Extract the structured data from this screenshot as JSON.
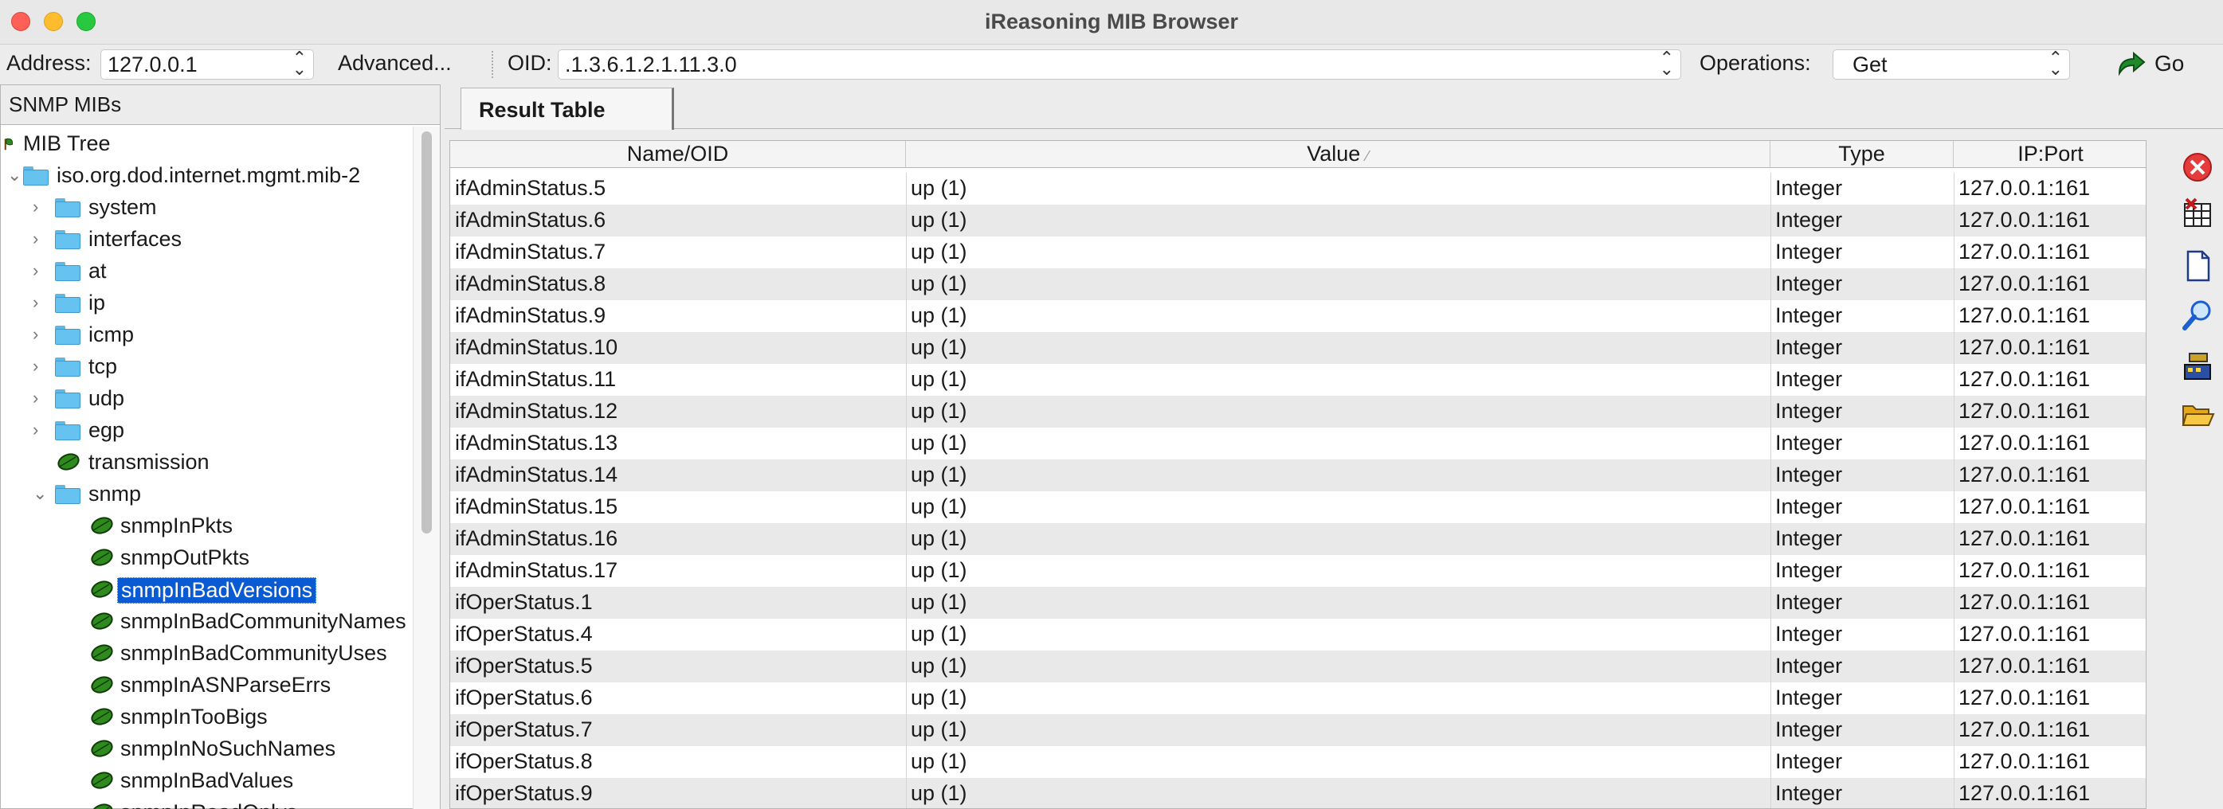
{
  "window": {
    "title": "iReasoning MIB Browser"
  },
  "toolbar": {
    "address_label": "Address:",
    "address_value": "127.0.0.1",
    "advanced_label": "Advanced...",
    "oid_label": "OID:",
    "oid_value": ".1.3.6.1.2.1.11.3.0",
    "operations_label": "Operations:",
    "operation_value": "Get",
    "go_label": "Go"
  },
  "left_panel": {
    "header": "SNMP MIBs",
    "tree": [
      {
        "label": "MIB Tree",
        "icon": "tree-icon",
        "depth": 0,
        "chevron": ""
      },
      {
        "label": "iso.org.dod.internet.mgmt.mib-2",
        "icon": "folder-icon",
        "depth": 1,
        "chevron": "expanded"
      },
      {
        "label": "system",
        "icon": "folder-icon",
        "depth": 2,
        "chevron": "collapsed"
      },
      {
        "label": "interfaces",
        "icon": "folder-icon",
        "depth": 2,
        "chevron": "collapsed"
      },
      {
        "label": "at",
        "icon": "folder-icon",
        "depth": 2,
        "chevron": "collapsed"
      },
      {
        "label": "ip",
        "icon": "folder-icon",
        "depth": 2,
        "chevron": "collapsed"
      },
      {
        "label": "icmp",
        "icon": "folder-icon",
        "depth": 2,
        "chevron": "collapsed"
      },
      {
        "label": "tcp",
        "icon": "folder-icon",
        "depth": 2,
        "chevron": "collapsed"
      },
      {
        "label": "udp",
        "icon": "folder-icon",
        "depth": 2,
        "chevron": "collapsed"
      },
      {
        "label": "egp",
        "icon": "folder-icon",
        "depth": 2,
        "chevron": "collapsed"
      },
      {
        "label": "transmission",
        "icon": "leaf-icon",
        "depth": 2,
        "chevron": ""
      },
      {
        "label": "snmp",
        "icon": "folder-icon",
        "depth": 2,
        "chevron": "expanded"
      },
      {
        "label": "snmpInPkts",
        "icon": "leaf-icon",
        "depth": 3,
        "chevron": ""
      },
      {
        "label": "snmpOutPkts",
        "icon": "leaf-icon",
        "depth": 3,
        "chevron": ""
      },
      {
        "label": "snmpInBadVersions",
        "icon": "leaf-icon",
        "depth": 3,
        "chevron": "",
        "selected": true
      },
      {
        "label": "snmpInBadCommunityNames",
        "icon": "leaf-icon",
        "depth": 3,
        "chevron": ""
      },
      {
        "label": "snmpInBadCommunityUses",
        "icon": "leaf-icon",
        "depth": 3,
        "chevron": ""
      },
      {
        "label": "snmpInASNParseErrs",
        "icon": "leaf-icon",
        "depth": 3,
        "chevron": ""
      },
      {
        "label": "snmpInTooBigs",
        "icon": "leaf-icon",
        "depth": 3,
        "chevron": ""
      },
      {
        "label": "snmpInNoSuchNames",
        "icon": "leaf-icon",
        "depth": 3,
        "chevron": ""
      },
      {
        "label": "snmpInBadValues",
        "icon": "leaf-icon",
        "depth": 3,
        "chevron": ""
      },
      {
        "label": "snmpInReadOnlys",
        "icon": "leaf-icon",
        "depth": 3,
        "chevron": ""
      }
    ]
  },
  "right_panel": {
    "tab_label": "Result Table",
    "columns": [
      "Name/OID",
      "Value",
      "Type",
      "IP:Port"
    ],
    "rows": [
      [
        "ifAdminStatus.5",
        "up (1)",
        "Integer",
        "127.0.0.1:161"
      ],
      [
        "ifAdminStatus.6",
        "up (1)",
        "Integer",
        "127.0.0.1:161"
      ],
      [
        "ifAdminStatus.7",
        "up (1)",
        "Integer",
        "127.0.0.1:161"
      ],
      [
        "ifAdminStatus.8",
        "up (1)",
        "Integer",
        "127.0.0.1:161"
      ],
      [
        "ifAdminStatus.9",
        "up (1)",
        "Integer",
        "127.0.0.1:161"
      ],
      [
        "ifAdminStatus.10",
        "up (1)",
        "Integer",
        "127.0.0.1:161"
      ],
      [
        "ifAdminStatus.11",
        "up (1)",
        "Integer",
        "127.0.0.1:161"
      ],
      [
        "ifAdminStatus.12",
        "up (1)",
        "Integer",
        "127.0.0.1:161"
      ],
      [
        "ifAdminStatus.13",
        "up (1)",
        "Integer",
        "127.0.0.1:161"
      ],
      [
        "ifAdminStatus.14",
        "up (1)",
        "Integer",
        "127.0.0.1:161"
      ],
      [
        "ifAdminStatus.15",
        "up (1)",
        "Integer",
        "127.0.0.1:161"
      ],
      [
        "ifAdminStatus.16",
        "up (1)",
        "Integer",
        "127.0.0.1:161"
      ],
      [
        "ifAdminStatus.17",
        "up (1)",
        "Integer",
        "127.0.0.1:161"
      ],
      [
        "ifOperStatus.1",
        "up (1)",
        "Integer",
        "127.0.0.1:161"
      ],
      [
        "ifOperStatus.4",
        "up (1)",
        "Integer",
        "127.0.0.1:161"
      ],
      [
        "ifOperStatus.5",
        "up (1)",
        "Integer",
        "127.0.0.1:161"
      ],
      [
        "ifOperStatus.6",
        "up (1)",
        "Integer",
        "127.0.0.1:161"
      ],
      [
        "ifOperStatus.7",
        "up (1)",
        "Integer",
        "127.0.0.1:161"
      ],
      [
        "ifOperStatus.8",
        "up (1)",
        "Integer",
        "127.0.0.1:161"
      ],
      [
        "ifOperStatus.9",
        "up (1)",
        "Integer",
        "127.0.0.1:161"
      ]
    ]
  },
  "side_tools": [
    {
      "icon": "close-circle-icon"
    },
    {
      "icon": "delete-table-icon"
    },
    {
      "icon": "document-icon"
    },
    {
      "icon": "search-magnifier-icon"
    },
    {
      "icon": "network-device-icon"
    },
    {
      "icon": "open-folder-icon"
    }
  ],
  "colors": {
    "selection": "#0a5bd3",
    "row_alt": "#e9e9e9",
    "folder": "#66c2ef",
    "leaf": "#2f8a1e"
  }
}
